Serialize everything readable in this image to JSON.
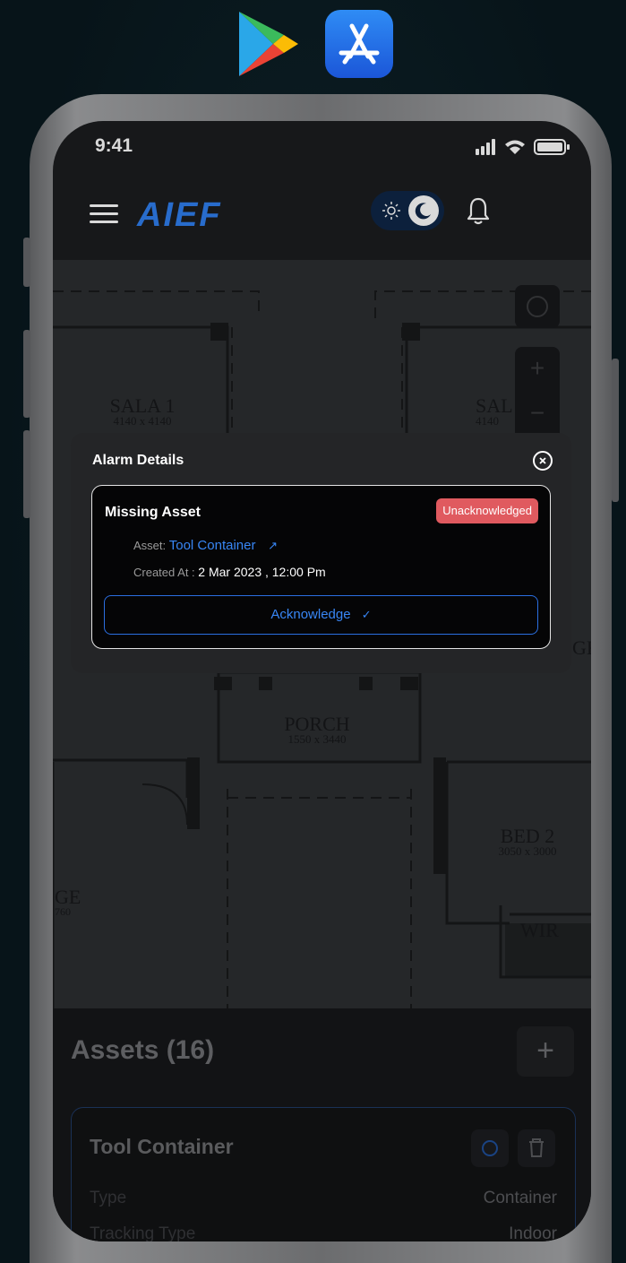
{
  "status": {
    "time": "9:41"
  },
  "header": {
    "logo": "AIEF"
  },
  "map": {
    "labels": [
      {
        "name": "SALA 1",
        "size": "4140 x 4140"
      },
      {
        "name": "SAL",
        "size": "4140"
      },
      {
        "name": "PORCH",
        "size": "1550 x 3440"
      },
      {
        "name": "BED 2",
        "size": "3050 x 3000"
      },
      {
        "name": "GE",
        "size": "760"
      },
      {
        "name": "WIR",
        "size": ""
      },
      {
        "name": "GR",
        "size": ""
      }
    ]
  },
  "modal": {
    "title": "Alarm Details",
    "card_title": "Missing Asset",
    "badge": "Unacknowledged",
    "asset_label": "Asset:",
    "asset_value": "Tool Container",
    "created_label": "Created At :",
    "created_value": "2 Mar 2023 , 12:00 Pm",
    "ack_label": "Acknowledge",
    "ack_icon": "✓",
    "link_icon": "↗"
  },
  "assets": {
    "title": "Assets (16)",
    "add_icon": "+",
    "card": {
      "name": "Tool Container",
      "type_label": "Type",
      "type_value": "Container",
      "tracking_label": "Tracking Type",
      "tracking_value": "Indoor"
    }
  }
}
